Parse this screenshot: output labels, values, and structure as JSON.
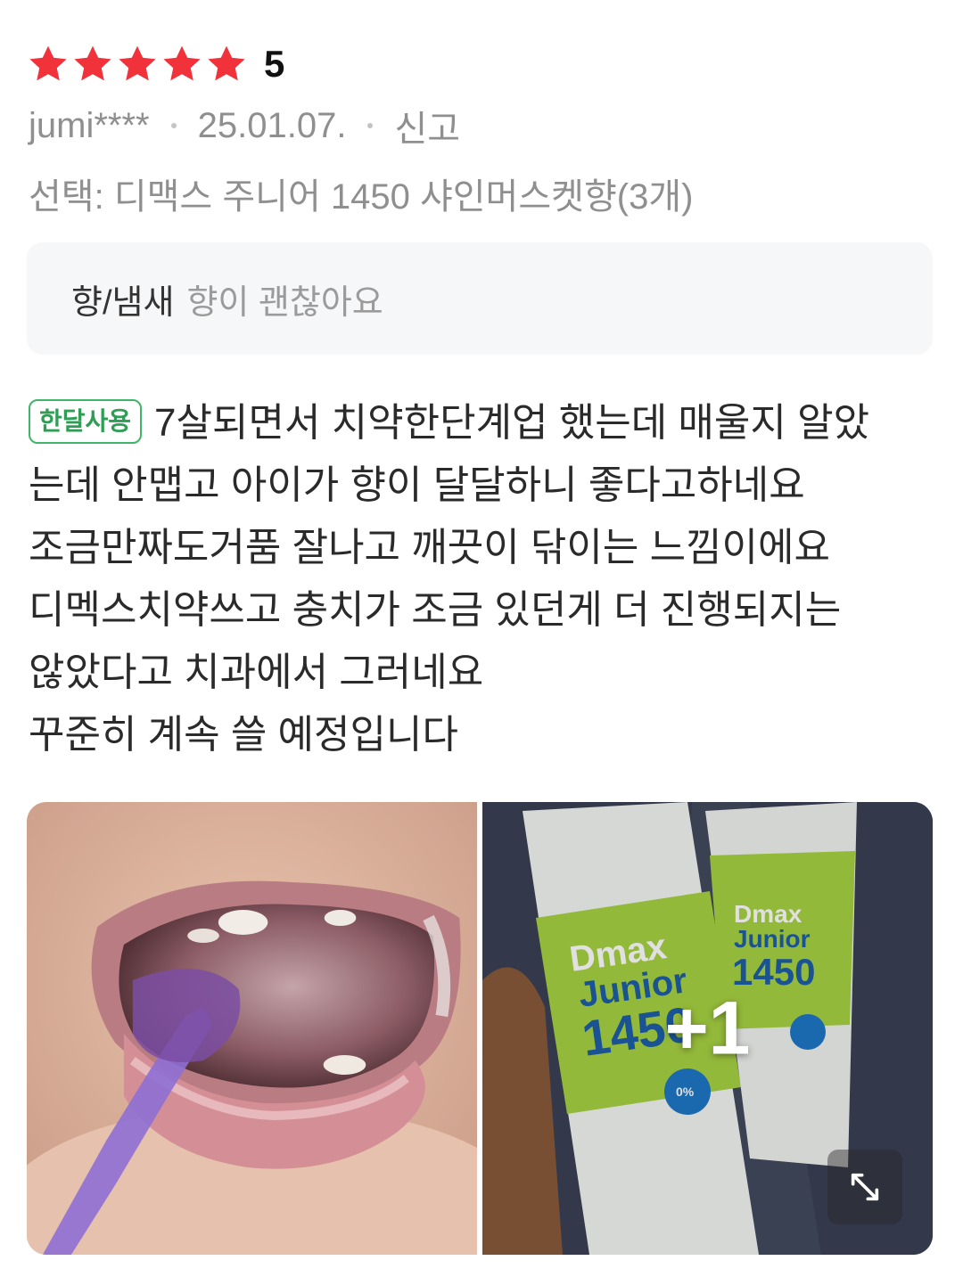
{
  "review": {
    "rating": {
      "value": "5",
      "stars": 5,
      "star_color": "#f2323a"
    },
    "author": "jumi****",
    "date": "25.01.07.",
    "report_label": "신고",
    "option": "선택: 디맥스 주니어 1450 샤인머스켓향(3개)",
    "attribute": {
      "key": "향/냄새",
      "value": "향이 괜찮아요"
    },
    "badge": "한달사용",
    "body_lines": [
      "7살되면서 치약한단계업 했는데 매울지 알았",
      "는데 안맵고 아이가 향이 달달하니 좋다고하네요",
      "조금만짜도거품 잘나고 깨끗이 닦이는 느낌이에요",
      "디멕스치약쓰고 충치가 조금 있던게 더 진행되지는",
      "않았다고 치과에서 그러네요",
      "꾸준히 계속 쓸 예정입니다"
    ],
    "photos": {
      "more_count": "+1",
      "product_text": {
        "brand": "Dmax",
        "line": "Junior",
        "number": "1450",
        "badge": "0%"
      },
      "expand_icon": "expand-icon"
    }
  }
}
